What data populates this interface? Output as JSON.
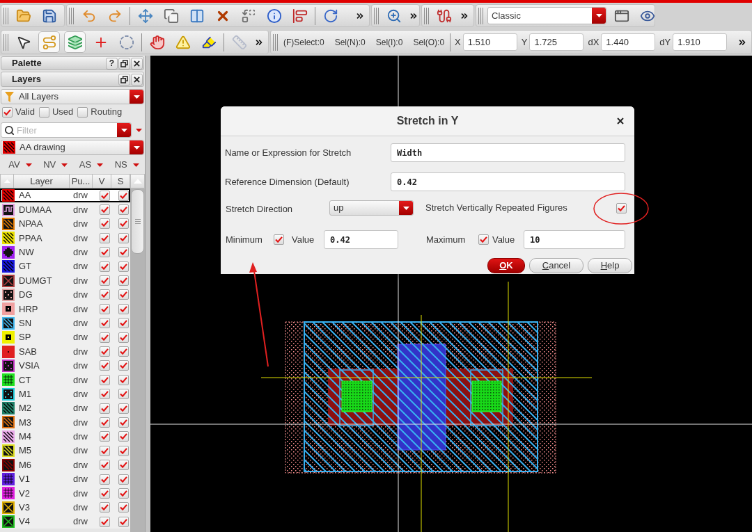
{
  "workspace_select": {
    "value": "Classic"
  },
  "edit_tools": [
    {
      "pressed": false,
      "disabled": false
    },
    {
      "pressed": true,
      "disabled": false
    },
    {
      "pressed": true,
      "disabled": false
    },
    {
      "pressed": false,
      "disabled": false
    },
    {
      "pressed": false,
      "disabled": false
    },
    {
      "pressed": false,
      "disabled": false
    },
    {
      "pressed": false,
      "disabled": false
    },
    {
      "pressed": false,
      "disabled": false
    },
    {
      "pressed": false,
      "disabled": true
    }
  ],
  "selection_counts": [
    "(F)Select:0",
    "Sel(N):0",
    "Sel(I):0",
    "Sel(O):0"
  ],
  "coordinates": [
    {
      "label": "X",
      "value": "1.510"
    },
    {
      "label": "Y",
      "value": "1.725"
    },
    {
      "label": "dX",
      "value": "1.440"
    },
    {
      "label": "dY",
      "value": "1.910"
    }
  ],
  "palette": {
    "title": "Palette",
    "help": "?"
  },
  "layers": {
    "title": "Layers",
    "layer_set": "All Layers",
    "filters": [
      {
        "label": "Valid",
        "checked": true
      },
      {
        "label": "Used",
        "checked": false
      },
      {
        "label": "Routing",
        "checked": false
      }
    ],
    "search": {
      "placeholder": "Filter"
    },
    "current_layer": {
      "name": "AA drawing",
      "color": "#e00000"
    },
    "toggles": [
      "AV",
      "NV",
      "AS",
      "NS"
    ],
    "columns": [
      "Layer",
      "Pu...",
      "V",
      "S"
    ],
    "rows": [
      {
        "name": "AA",
        "purpose": "drw",
        "color": "#e00000",
        "v_checked": true,
        "s_checked": true,
        "selected": true
      },
      {
        "name": "DUMAA",
        "purpose": "drw",
        "color": "#e0a0e0",
        "v_checked": true,
        "s_checked": true,
        "selected": false
      },
      {
        "name": "NPAA",
        "purpose": "drw",
        "color": "#e07800",
        "v_checked": true,
        "s_checked": true,
        "selected": false
      },
      {
        "name": "PPAA",
        "purpose": "drw",
        "color": "#e8e000",
        "v_checked": true,
        "s_checked": true,
        "selected": false
      },
      {
        "name": "NW",
        "purpose": "drw",
        "color": "#a020f0",
        "v_checked": true,
        "s_checked": true,
        "selected": false
      },
      {
        "name": "GT",
        "purpose": "drw",
        "color": "#1818e0",
        "v_checked": true,
        "s_checked": true,
        "selected": false
      },
      {
        "name": "DUMGT",
        "purpose": "drw",
        "color": "#b04040",
        "v_checked": true,
        "s_checked": true,
        "selected": false
      },
      {
        "name": "DG",
        "purpose": "drw",
        "color": "#e0a0a0",
        "v_checked": true,
        "s_checked": true,
        "selected": false
      },
      {
        "name": "HRP",
        "purpose": "drw",
        "color": "#f0a0a0",
        "v_checked": true,
        "s_checked": true,
        "selected": false
      },
      {
        "name": "SN",
        "purpose": "drw",
        "color": "#40b8f0",
        "v_checked": true,
        "s_checked": true,
        "selected": false
      },
      {
        "name": "SP",
        "purpose": "drw",
        "color": "#f0f000",
        "v_checked": true,
        "s_checked": true,
        "selected": false
      },
      {
        "name": "SAB",
        "purpose": "drw",
        "color": "#e02020",
        "v_checked": true,
        "s_checked": true,
        "selected": false
      },
      {
        "name": "VSIA",
        "purpose": "drw",
        "color": "#c030c0",
        "v_checked": true,
        "s_checked": true,
        "selected": false
      },
      {
        "name": "CT",
        "purpose": "drw",
        "color": "#20e020",
        "v_checked": true,
        "s_checked": true,
        "selected": false
      },
      {
        "name": "M1",
        "purpose": "drw",
        "color": "#20c8d8",
        "v_checked": true,
        "s_checked": true,
        "selected": false
      },
      {
        "name": "M2",
        "purpose": "drw",
        "color": "#208068",
        "v_checked": true,
        "s_checked": true,
        "selected": false
      },
      {
        "name": "M3",
        "purpose": "drw",
        "color": "#e07010",
        "v_checked": true,
        "s_checked": true,
        "selected": false
      },
      {
        "name": "M4",
        "purpose": "drw",
        "color": "#e8a8e8",
        "v_checked": true,
        "s_checked": true,
        "selected": false
      },
      {
        "name": "M5",
        "purpose": "drw",
        "color": "#e0e020",
        "v_checked": true,
        "s_checked": true,
        "selected": false
      },
      {
        "name": "M6",
        "purpose": "drw",
        "color": "#900000",
        "v_checked": true,
        "s_checked": true,
        "selected": false
      },
      {
        "name": "V1",
        "purpose": "drw",
        "color": "#6020e0",
        "v_checked": true,
        "s_checked": true,
        "selected": false
      },
      {
        "name": "V2",
        "purpose": "drw",
        "color": "#e020e0",
        "v_checked": true,
        "s_checked": true,
        "selected": false
      },
      {
        "name": "V3",
        "purpose": "drw",
        "color": "#e0b000",
        "v_checked": true,
        "s_checked": true,
        "selected": false
      },
      {
        "name": "V4",
        "purpose": "drw",
        "color": "#20c020",
        "v_checked": true,
        "s_checked": true,
        "selected": false
      }
    ]
  },
  "dialog": {
    "title": "Stretch in Y",
    "text_fields": [
      {
        "label": "Name or Expression for Stretch",
        "value": "Width"
      },
      {
        "label": "Reference Dimension (Default)",
        "value": "0.42"
      }
    ],
    "direction": {
      "label": "Stretch Direction",
      "value": "up"
    },
    "repeated": {
      "label": "Stretch Vertically Repeated Figures",
      "checked": true
    },
    "limits": [
      {
        "label": "Minimum",
        "checked": true,
        "value_label": "Value",
        "value": "0.42"
      },
      {
        "label": "Maximum",
        "checked": true,
        "value_label": "Value",
        "value": "10"
      }
    ],
    "buttons": [
      {
        "label": "OK",
        "primary": true
      },
      {
        "label": "Cancel",
        "primary": false
      },
      {
        "label": "Help",
        "primary": false
      }
    ]
  }
}
